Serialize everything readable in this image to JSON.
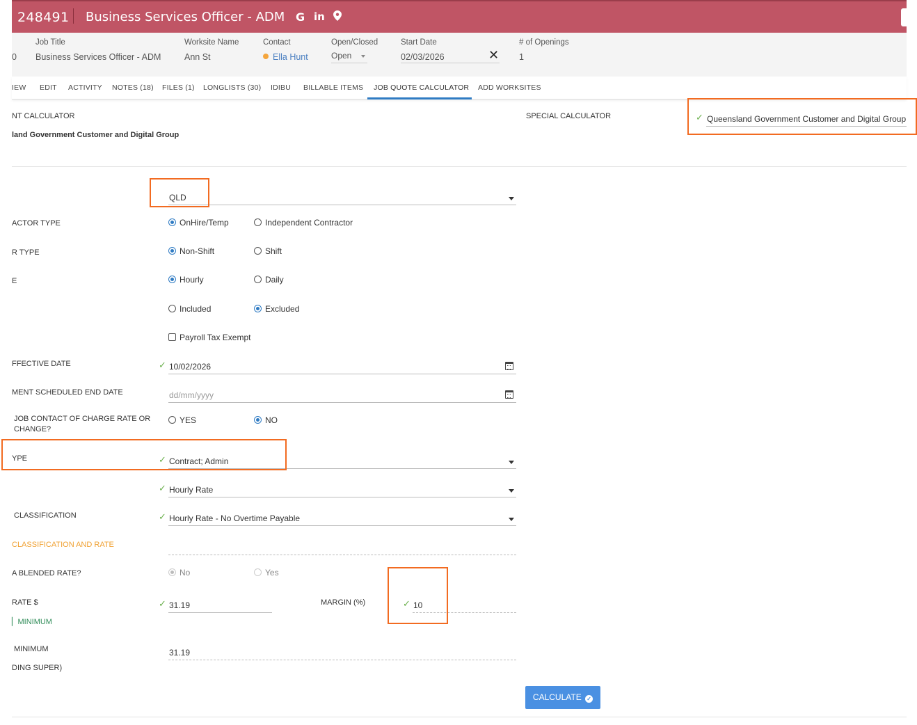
{
  "header": {
    "job_id": "248491",
    "title": "Business Services Officer - ADM",
    "icons": [
      "google-icon",
      "linkedin-icon",
      "map-pin-icon"
    ]
  },
  "info": {
    "left_fragment": "0",
    "job_title_label": "Job Title",
    "job_title": "Business Services Officer - ADM",
    "worksite_label": "Worksite Name",
    "worksite": "Ann St",
    "contact_label": "Contact",
    "contact": "Ella Hunt",
    "open_closed_label": "Open/Closed",
    "open_closed": "Open",
    "start_date_label": "Start Date",
    "start_date": "02/03/2026",
    "openings_label": "# of Openings",
    "openings": "1"
  },
  "tabs": [
    {
      "label": "IEW"
    },
    {
      "label": "EDIT"
    },
    {
      "label": "ACTIVITY"
    },
    {
      "label": "NOTES (18)"
    },
    {
      "label": "FILES (1)"
    },
    {
      "label": "LONGLISTS (30)"
    },
    {
      "label": "IDIBU"
    },
    {
      "label": "BILLABLE ITEMS"
    },
    {
      "label": "JOB QUOTE CALCULATOR"
    },
    {
      "label": "ADD WORKSITES"
    }
  ],
  "calculator": {
    "client_calc_label": "NT CALCULATOR",
    "client_calc_value": "land Government Customer and Digital Group",
    "special_calc_label": "SPECIAL CALCULATOR",
    "special_calc_value": "Queensland Government Customer and Digital Group"
  },
  "form": {
    "state": "QLD",
    "contractor_type_label": "ACTOR TYPE",
    "contractor_type_options": [
      "OnHire/Temp",
      "Independent Contractor"
    ],
    "worker_type_label": "R TYPE",
    "worker_type_options": [
      "Non-Shift",
      "Shift"
    ],
    "rate_label": "E",
    "rate_options": [
      "Hourly",
      "Daily"
    ],
    "super_options": [
      "Included",
      "Excluded"
    ],
    "payroll_tax_label": "Payroll Tax Exempt",
    "effective_date_label": "FFECTIVE DATE",
    "effective_date": "10/02/2026",
    "end_date_label": "MENT SCHEDULED END DATE",
    "end_date_placeholder": "dd/mm/yyyy",
    "notify_label_1": "JOB CONTACT OF CHARGE RATE OR",
    "notify_label_2": "CHANGE?",
    "notify_options": [
      "YES",
      "NO"
    ],
    "award_type_label": "YPE",
    "award_type": "Contract; Admin",
    "rate_type": "Hourly Rate",
    "classification_label": "CLASSIFICATION",
    "classification": "Hourly Rate - No Overtime Payable",
    "classification_rate_label": "CLASSIFICATION AND RATE",
    "blended_label": "A BLENDED RATE?",
    "blended_options": [
      "No",
      "Yes"
    ],
    "pay_rate_label": "RATE $",
    "pay_rate": "31.19",
    "margin_label": "MARGIN (%)",
    "margin": "10",
    "min_link_label": "MINIMUM",
    "minimum_label": "MINIMUM",
    "minimum_label_2": "DING SUPER)",
    "minimum_value": "31.19",
    "calculate_label": "CALCULATE"
  },
  "colors": {
    "header": "#c05565",
    "accent": "#2f7bc3",
    "highlight": "#f26b21",
    "check": "#6ab04c",
    "button": "#4a90e2"
  }
}
